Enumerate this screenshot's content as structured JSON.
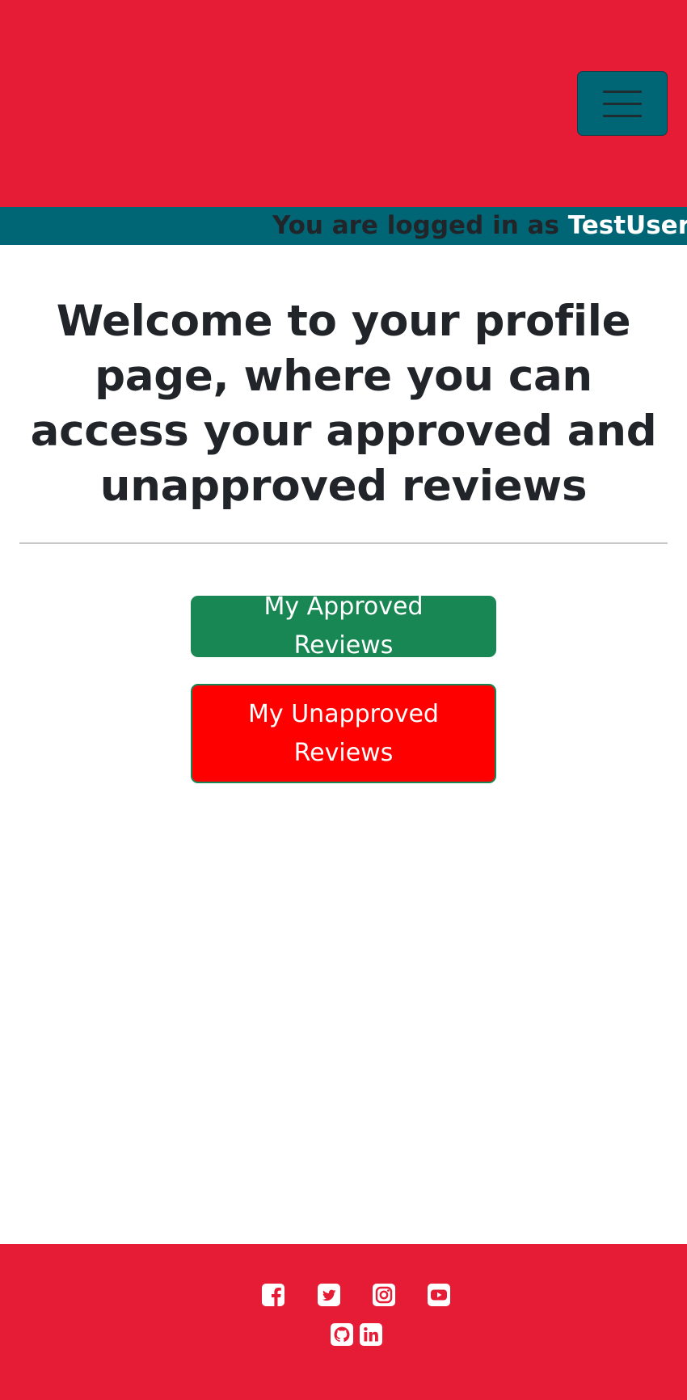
{
  "navbar": {
    "background_color": "#e61c36",
    "toggler_color": "#006675",
    "toggler_icon": "hamburger-menu-icon"
  },
  "status_bar": {
    "background_color": "#006675",
    "prefix": "You are logged in as",
    "username": "TestUser"
  },
  "main": {
    "heading": "Welcome to your profile page, where you can access your approved and unapproved reviews",
    "approved_button": {
      "label": "My Approved Reviews",
      "color": "#198754"
    },
    "unapproved_button": {
      "label": "My Unapproved Reviews",
      "color": "#ff0000"
    }
  },
  "footer": {
    "background_color": "#e61c36",
    "social_icons": [
      "facebook-icon",
      "twitter-icon",
      "instagram-icon",
      "youtube-icon",
      "github-icon",
      "linkedin-icon"
    ]
  }
}
